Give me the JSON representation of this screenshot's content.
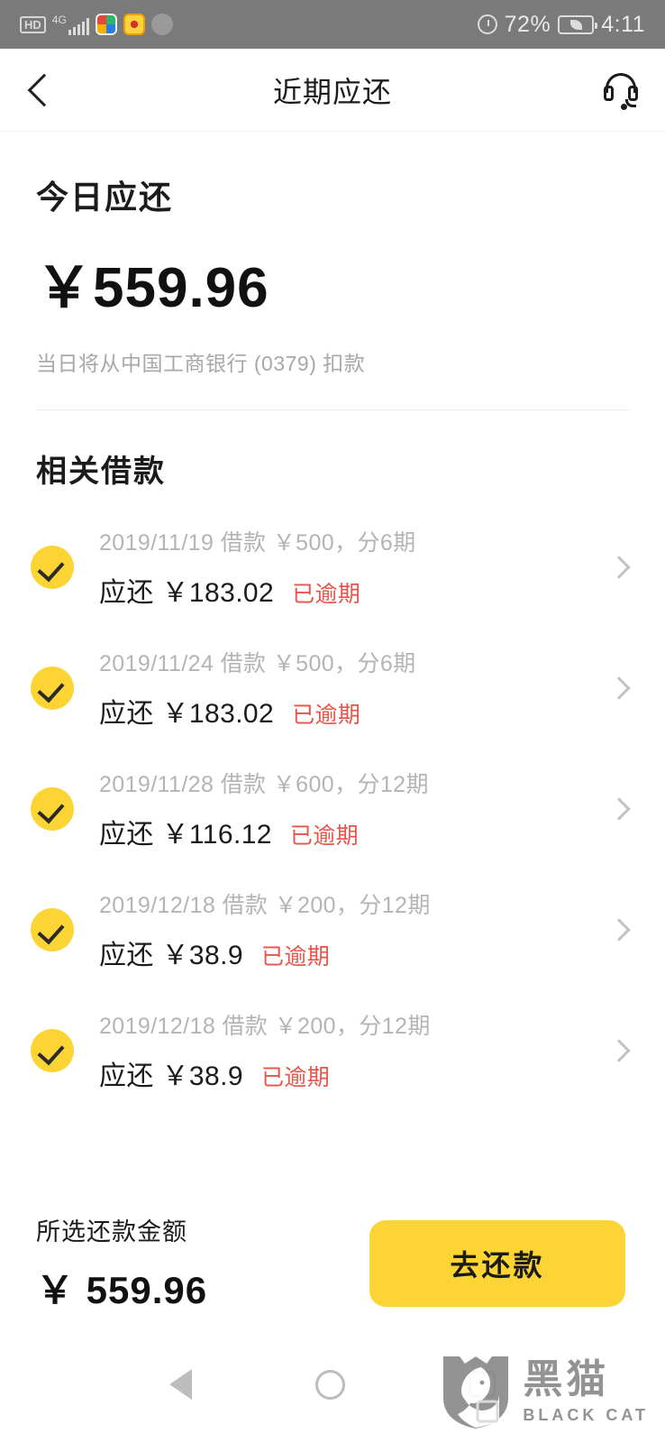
{
  "status_bar": {
    "hd_label": "HD",
    "network_label": "4G",
    "battery_percent": "72%",
    "time": "4:11",
    "icons": [
      "hd-icon",
      "signal-bars-icon",
      "qq-browser-icon",
      "weibo-icon",
      "wechat-icon",
      "alarm-icon",
      "battery-saver-icon"
    ]
  },
  "header": {
    "title": "近期应还",
    "back_icon": "back-chevron-icon",
    "support_icon": "headset-icon"
  },
  "summary": {
    "title": "今日应还",
    "amount": "￥559.96",
    "note": "当日将从中国工商银行 (0379) 扣款"
  },
  "loans_section": {
    "title": "相关借款",
    "items": [
      {
        "meta": "2019/11/19 借款 ￥500，分6期",
        "due_label": "应还 ￥183.02",
        "status": "已逾期",
        "checked": true
      },
      {
        "meta": "2019/11/24 借款 ￥500，分6期",
        "due_label": "应还 ￥183.02",
        "status": "已逾期",
        "checked": true
      },
      {
        "meta": "2019/11/28 借款 ￥600，分12期",
        "due_label": "应还 ￥116.12",
        "status": "已逾期",
        "checked": true
      },
      {
        "meta": "2019/12/18 借款 ￥200，分12期",
        "due_label": "应还 ￥38.9",
        "status": "已逾期",
        "checked": true
      },
      {
        "meta": "2019/12/18 借款 ￥200，分12期",
        "due_label": "应还 ￥38.9",
        "status": "已逾期",
        "checked": true
      }
    ]
  },
  "bottom_bar": {
    "selected_label": "所选还款金额",
    "selected_amount": "￥ 559.96",
    "repay_button": "去还款"
  },
  "nav_bar": {
    "back_icon": "nav-back-triangle-icon",
    "home_icon": "nav-home-circle-icon",
    "recents_icon": "nav-recents-square-icon"
  },
  "watermark": {
    "cn": "黑猫",
    "en": "BLACK CAT",
    "icon": "black-cat-shield-icon"
  },
  "colors": {
    "accent_yellow": "#FCD535",
    "overdue_red": "#e8544a",
    "status_bar_gray": "#7a7a7a",
    "muted_text": "#b4b4b4"
  }
}
